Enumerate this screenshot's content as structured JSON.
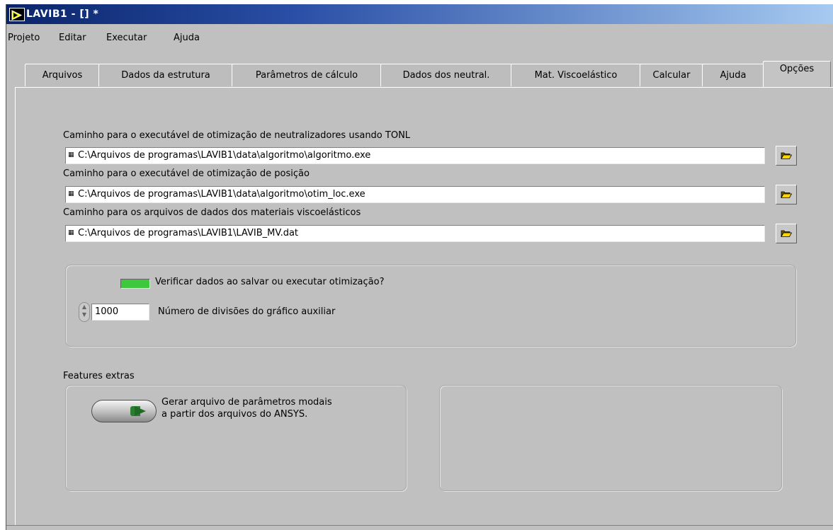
{
  "window": {
    "title": "LAVIB1 - [] *",
    "icon": "labview-run-icon"
  },
  "menubar": {
    "items": [
      "Projeto",
      "Editar",
      "Executar",
      "Ajuda"
    ]
  },
  "tabs": {
    "items": [
      "Arquivos",
      "Dados da estrutura",
      "Parâmetros de cálculo",
      "Dados dos neutral.",
      "Mat. Viscoelástico",
      "Calcular",
      "Ajuda",
      "Opções"
    ],
    "active": "Opções"
  },
  "paths": [
    {
      "label": "Caminho para o executável de otimização de neutralizadores usando TONL",
      "value": "C:\\Arquivos de programas\\LAVIB1\\data\\algoritmo\\algoritmo.exe"
    },
    {
      "label": "Caminho para o executável de otimização de posição",
      "value": "C:\\Arquivos de programas\\LAVIB1\\data\\algoritmo\\otim_loc.exe"
    },
    {
      "label": "Caminho para os arquivos de dados dos materiais viscoelásticos",
      "value": "C:\\Arquivos de programas\\LAVIB1\\LAVIB_MV.dat"
    }
  ],
  "settings": {
    "verify_label": "Verificar dados ao salvar ou executar otimização?",
    "verify_on": true,
    "divisions_value": "1000",
    "divisions_label": "Número de divisões do gráfico auxiliar"
  },
  "features": {
    "title": "Features extras",
    "ansys_line1": "Gerar arquivo de parâmetros modais",
    "ansys_line2": "a partir dos arquivos do ANSYS."
  },
  "colors": {
    "title_start": "#0a246a",
    "title_end": "#a6caf0",
    "panel": "#c0c0c0",
    "led_on": "#3ec83e"
  }
}
